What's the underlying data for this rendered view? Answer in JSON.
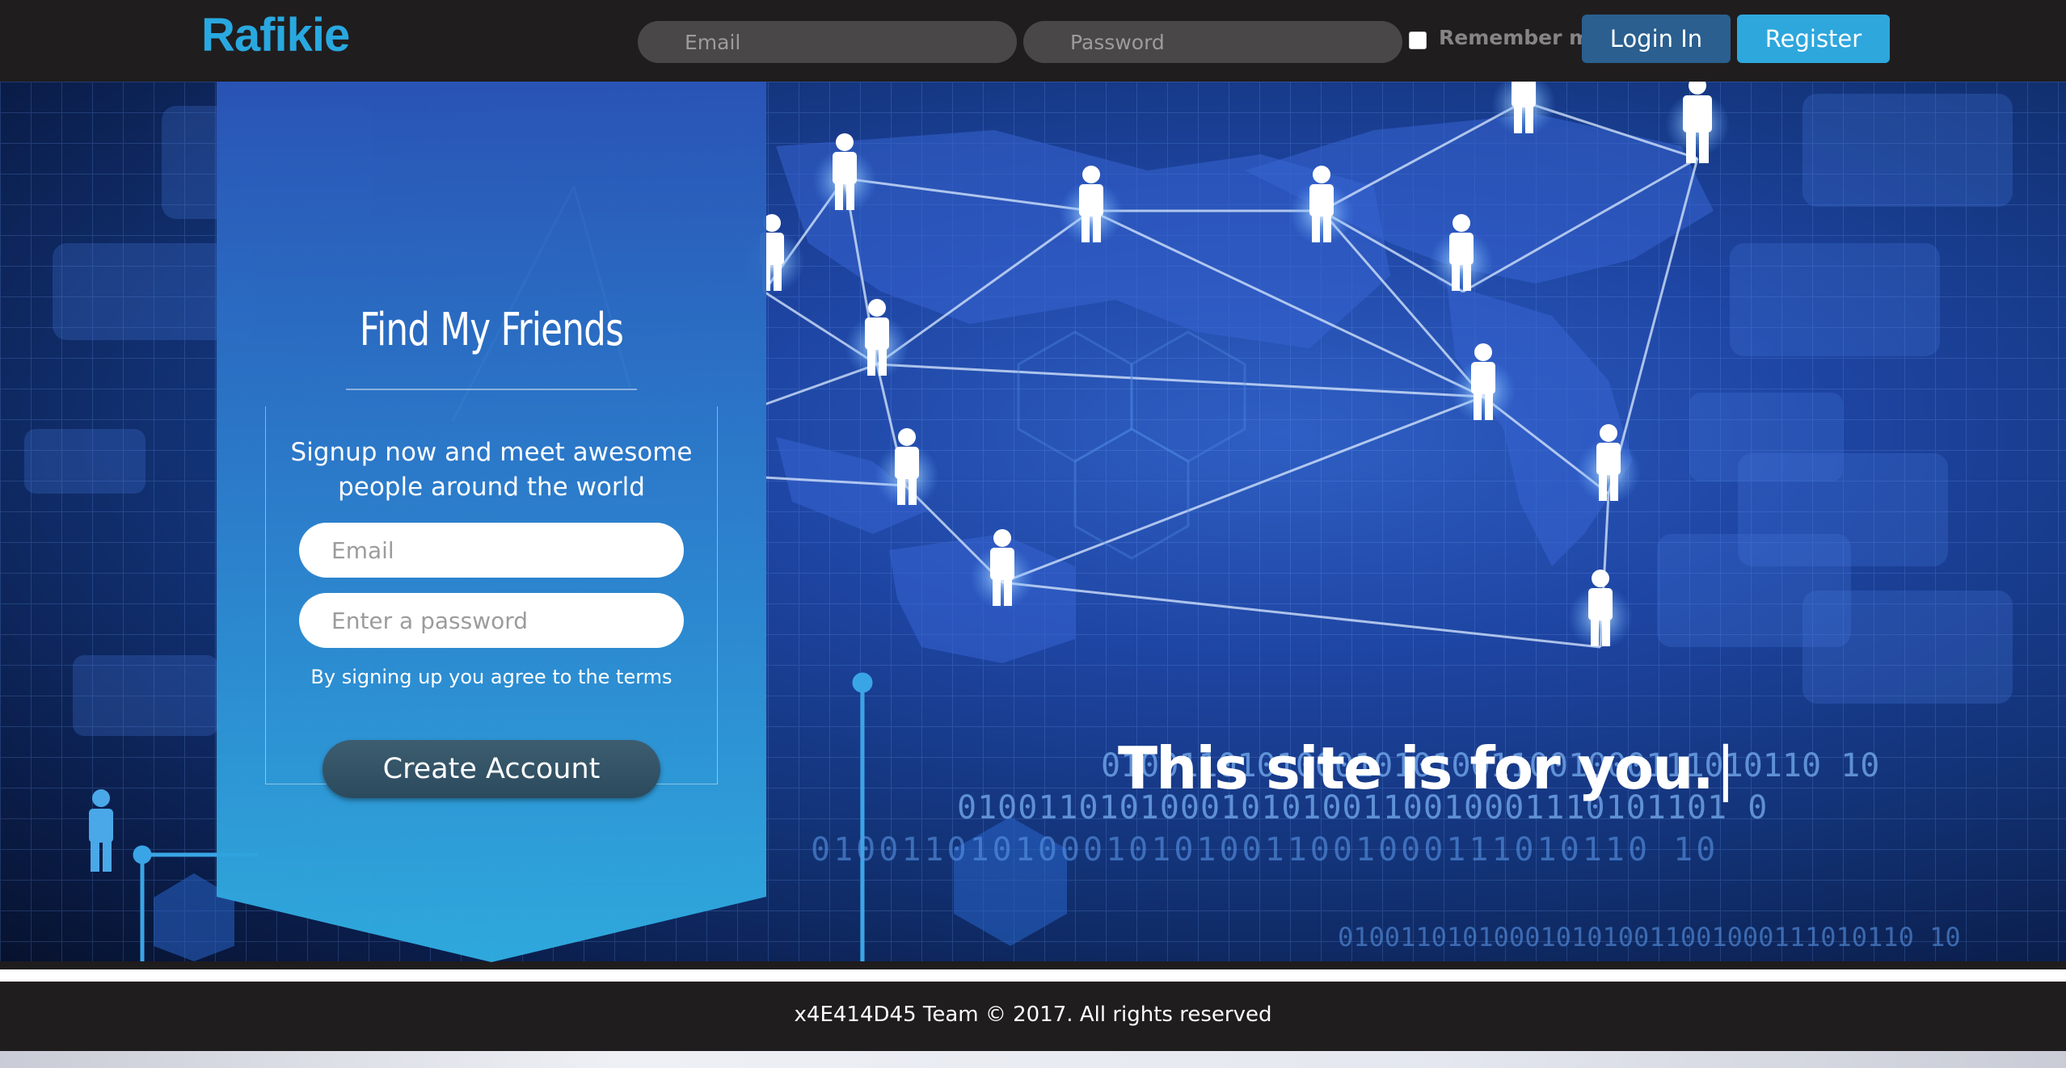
{
  "brand": {
    "name": "Rafikie",
    "color": "#29a8e0"
  },
  "login": {
    "email_placeholder": "Email",
    "password_placeholder": "Password",
    "remember_label": "Remember me",
    "login_label": "Login In",
    "register_label": "Register"
  },
  "signup": {
    "title": "Find My Friends",
    "subtitle_line1": "Signup now and meet awesome",
    "subtitle_line2": "people around the world",
    "email_placeholder": "Email",
    "password_placeholder": "Enter a password",
    "terms": "By signing up you agree to the terms",
    "create_label": "Create Account"
  },
  "hero": {
    "tagline": "This site is for you.",
    "cursor": "|",
    "binary_1": "0100110101000101010011001000111010110 10",
    "binary_2": "01001101010001010100110010001110101101 0",
    "binary_3": "0100110101000101010011001000111010110 10",
    "binary_4": "0100110101000101010011001000111010110 10"
  },
  "footer": {
    "text": "x4E414D45 Team © 2017. All rights reserved"
  },
  "colors": {
    "topbar": "#201d1e",
    "login_button": "#2a5f8f",
    "register_button": "#2ea7dd",
    "panel_top": "#2a55b8",
    "panel_bottom": "#30aee2"
  }
}
